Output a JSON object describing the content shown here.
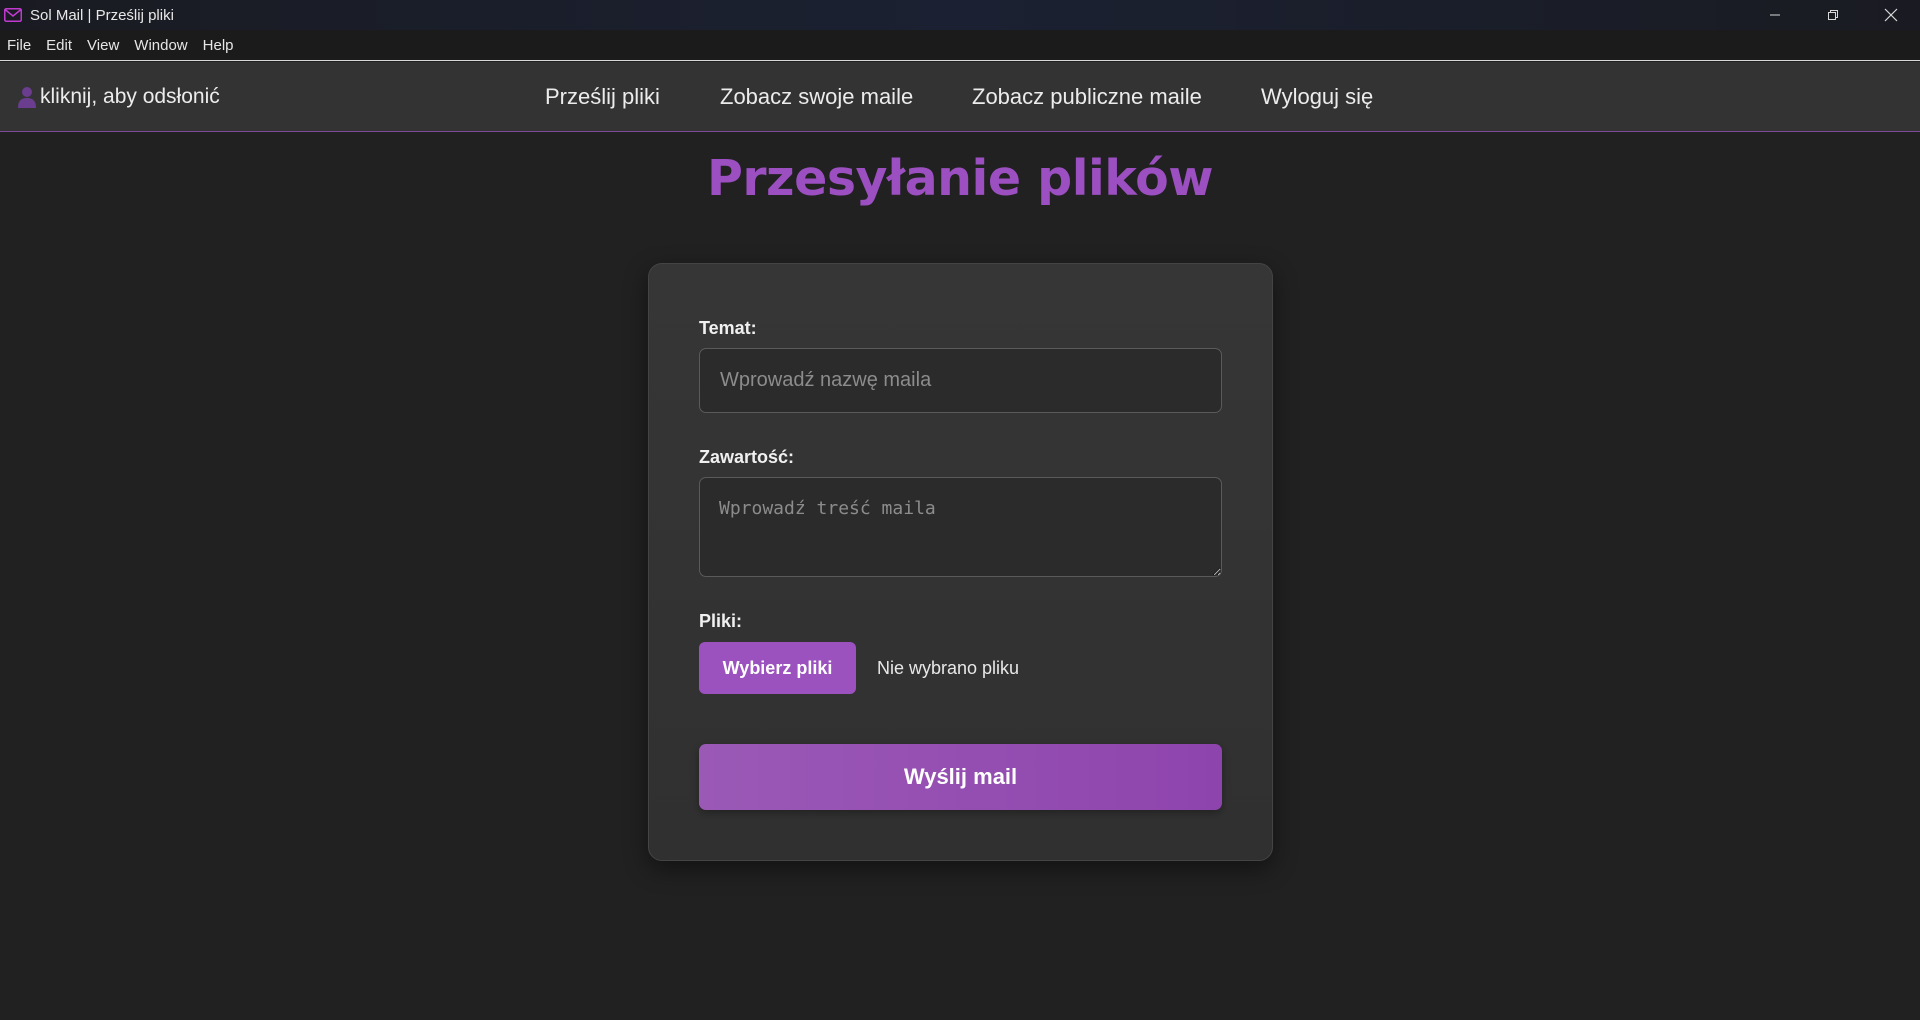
{
  "window": {
    "title": "Sol Mail | Prześlij pliki",
    "app_icon": "mail-icon",
    "controls": [
      "minimize-icon",
      "restore-icon",
      "close-icon"
    ]
  },
  "menubar": {
    "items": [
      "File",
      "Edit",
      "View",
      "Window",
      "Help"
    ]
  },
  "navbar": {
    "user_icon": "user-icon",
    "user_reveal": "kliknij, aby odsłonić",
    "links": [
      "Prześlij pliki",
      "Zobacz swoje maile",
      "Zobacz publiczne maile",
      "Wyloguj się"
    ]
  },
  "main": {
    "title": "Przesyłanie plików",
    "form": {
      "subject_label": "Temat:",
      "subject_placeholder": "Wprowadź nazwę maila",
      "subject_value": "",
      "content_label": "Zawartość:",
      "content_placeholder": "Wprowadź treść maila",
      "content_value": "",
      "files_label": "Pliki:",
      "choose_files_button": "Wybierz pliki",
      "file_status": "Nie wybrano pliku",
      "submit_button": "Wyślij mail"
    }
  },
  "colors": {
    "accent": "#9b52bf",
    "background": "#212121",
    "navbar": "#333333",
    "card": "#333333"
  }
}
